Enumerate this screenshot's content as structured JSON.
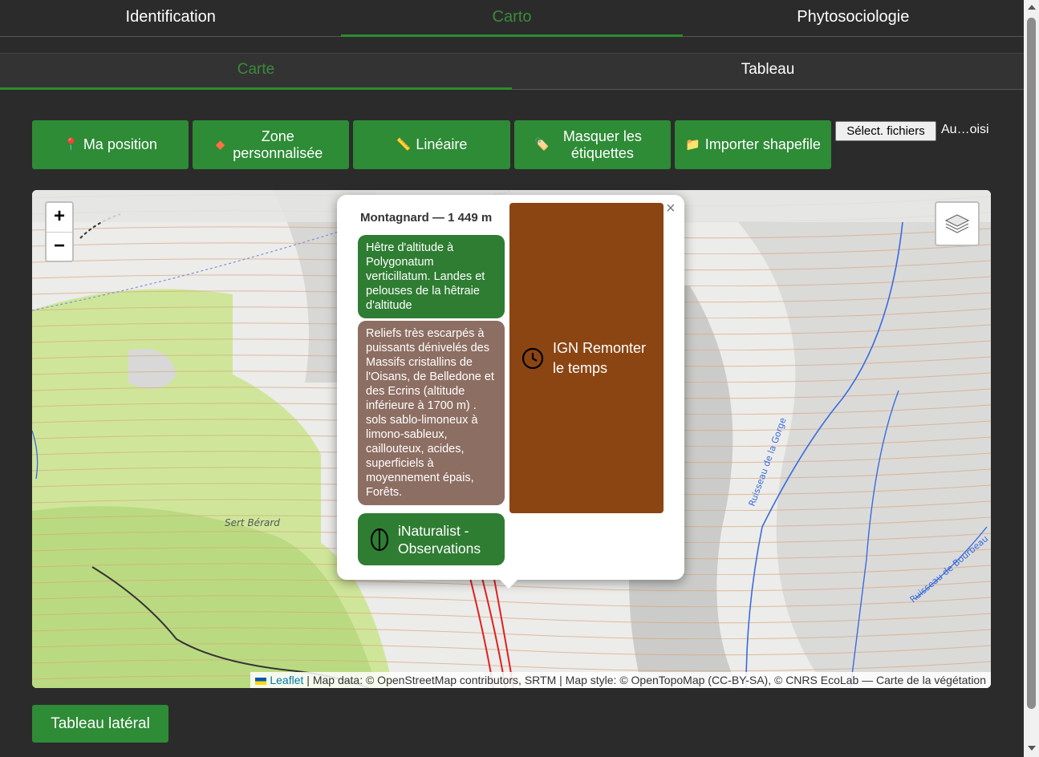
{
  "tabs_main": [
    {
      "label": "Identification",
      "active": false
    },
    {
      "label": "Carto",
      "active": true
    },
    {
      "label": "Phytosociologie",
      "active": false
    }
  ],
  "tabs_sub": [
    {
      "label": "Carte",
      "active": true
    },
    {
      "label": "Tableau",
      "active": false
    }
  ],
  "toolbar": {
    "ma_position": {
      "icon": "pin-icon",
      "label": "Ma position"
    },
    "zone": {
      "icon": "diamond-icon",
      "label": "Zone personnalisée"
    },
    "lineaire": {
      "icon": "ruler-icon",
      "label": "Linéaire"
    },
    "masquer": {
      "icon": "tag-icon",
      "label": "Masquer les étiquettes"
    },
    "importer": {
      "icon": "folder-icon",
      "label": "Importer shapefile"
    },
    "file_button": "Sélect. fichiers",
    "file_status": "Au…oisi"
  },
  "map": {
    "zoom_in": "+",
    "zoom_out": "−",
    "place_label": "Sert Bérard",
    "river_labels": [
      "Ruisseau de la Gorge",
      "Ruisseau de Bourbeau"
    ],
    "attribution_link": "Leaflet",
    "attribution_text": " | Map data: © OpenStreetMap contributors, SRTM | Map style: © OpenTopoMap (CC-BY-SA), © CNRS EcoLab — Carte de la végétation"
  },
  "popup": {
    "title": "Montagnard — 1 449 m",
    "close": "×",
    "habitat": "Hêtre d'altitude à Polygonatum verticillatum. Landes et pelouses de la hêtraie d'altitude",
    "relief": "Reliefs très escarpés à puissants dénivelés des Massifs cristallins de l'Oisans, de Belledone et des Ecrins (altitude inférieure à 1700 m) . sols sablo-limoneux à limono-sableux, caillouteux, acides, superficiels à moyennement épais, Forêts.",
    "inaturalist": "iNaturalist - Observations",
    "ign": "IGN Remonter le temps"
  },
  "bottom_button": "Tableau latéral",
  "colors": {
    "accent_green": "#2e8b36",
    "card_green": "#2e7d32",
    "card_taupe": "#8d6e63",
    "card_brown": "#8b4513"
  }
}
